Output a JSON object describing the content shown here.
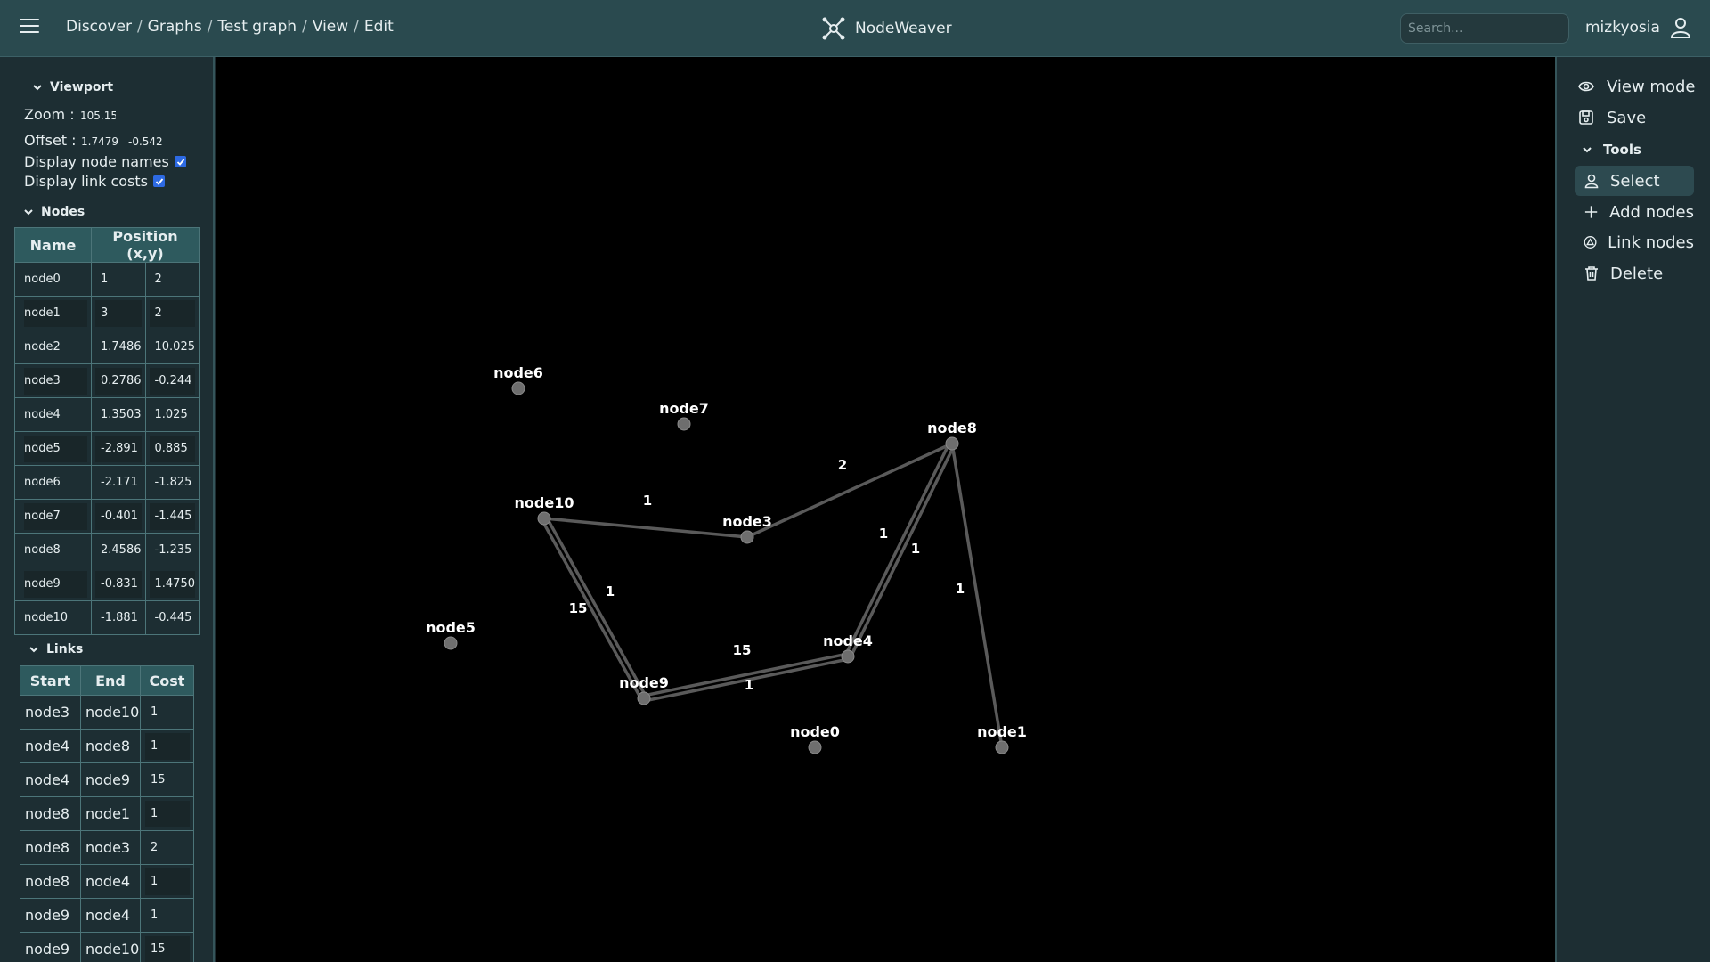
{
  "header": {
    "breadcrumbs": [
      "Discover",
      "Graphs",
      "Test graph",
      "View",
      "Edit"
    ],
    "brand": "NodeWeaver",
    "search_placeholder": "Search...",
    "username": "mizkyosia"
  },
  "viewport": {
    "title": "Viewport",
    "zoom_label": "Zoom :",
    "zoom": "105.15",
    "offset_label": "Offset :",
    "offset_x": "1.7479",
    "offset_y": "-0.542",
    "node_names_label": "Display node names :",
    "node_names_checked": true,
    "link_costs_label": "Display link costs :",
    "link_costs_checked": true
  },
  "nodes_section": {
    "title": "Nodes",
    "col_name": "Name",
    "col_position": "Position (x,y)",
    "rows": [
      {
        "name": "node0",
        "x": "1",
        "y": "2"
      },
      {
        "name": "node1",
        "x": "3",
        "y": "2"
      },
      {
        "name": "node2",
        "x": "1.7486",
        "y": "10.025"
      },
      {
        "name": "node3",
        "x": "0.2786",
        "y": "-0.244"
      },
      {
        "name": "node4",
        "x": "1.3503",
        "y": "1.025"
      },
      {
        "name": "node5",
        "x": "-2.891",
        "y": "0.885"
      },
      {
        "name": "node6",
        "x": "-2.171",
        "y": "-1.825"
      },
      {
        "name": "node7",
        "x": "-0.401",
        "y": "-1.445"
      },
      {
        "name": "node8",
        "x": "2.4586",
        "y": "-1.235"
      },
      {
        "name": "node9",
        "x": "-0.831",
        "y": "1.4750"
      },
      {
        "name": "node10",
        "x": "-1.881",
        "y": "-0.445"
      }
    ]
  },
  "links_section": {
    "title": "Links",
    "col_start": "Start",
    "col_end": "End",
    "col_cost": "Cost",
    "rows": [
      {
        "start": "node3",
        "end": "node10",
        "cost": "1"
      },
      {
        "start": "node4",
        "end": "node8",
        "cost": "1"
      },
      {
        "start": "node4",
        "end": "node9",
        "cost": "15"
      },
      {
        "start": "node8",
        "end": "node1",
        "cost": "1"
      },
      {
        "start": "node8",
        "end": "node3",
        "cost": "2"
      },
      {
        "start": "node8",
        "end": "node4",
        "cost": "1"
      },
      {
        "start": "node9",
        "end": "node4",
        "cost": "1"
      },
      {
        "start": "node9",
        "end": "node10",
        "cost": "15"
      }
    ]
  },
  "graph": {
    "node_color": "#6e6e6e",
    "edge_color": "#5a5a5a",
    "nodes": [
      "node0",
      "node1",
      "node3",
      "node4",
      "node5",
      "node6",
      "node7",
      "node8",
      "node9",
      "node10"
    ],
    "cost_labels": [
      "1",
      "2",
      "1",
      "1",
      "1",
      "15",
      "1",
      "15",
      "1"
    ]
  },
  "right_panel": {
    "view_mode": "View mode",
    "save": "Save",
    "tools_title": "Tools",
    "tools": [
      "Select",
      "Add nodes",
      "Link nodes",
      "Delete"
    ],
    "active_tool": "Select"
  },
  "colors": {
    "header_bg": "#2a4a4f",
    "panel_bg": "#1d2e33",
    "table_header_bg": "#2e5a5e",
    "checkbox": "#2d6ae3",
    "canvas_bg": "#000000"
  }
}
